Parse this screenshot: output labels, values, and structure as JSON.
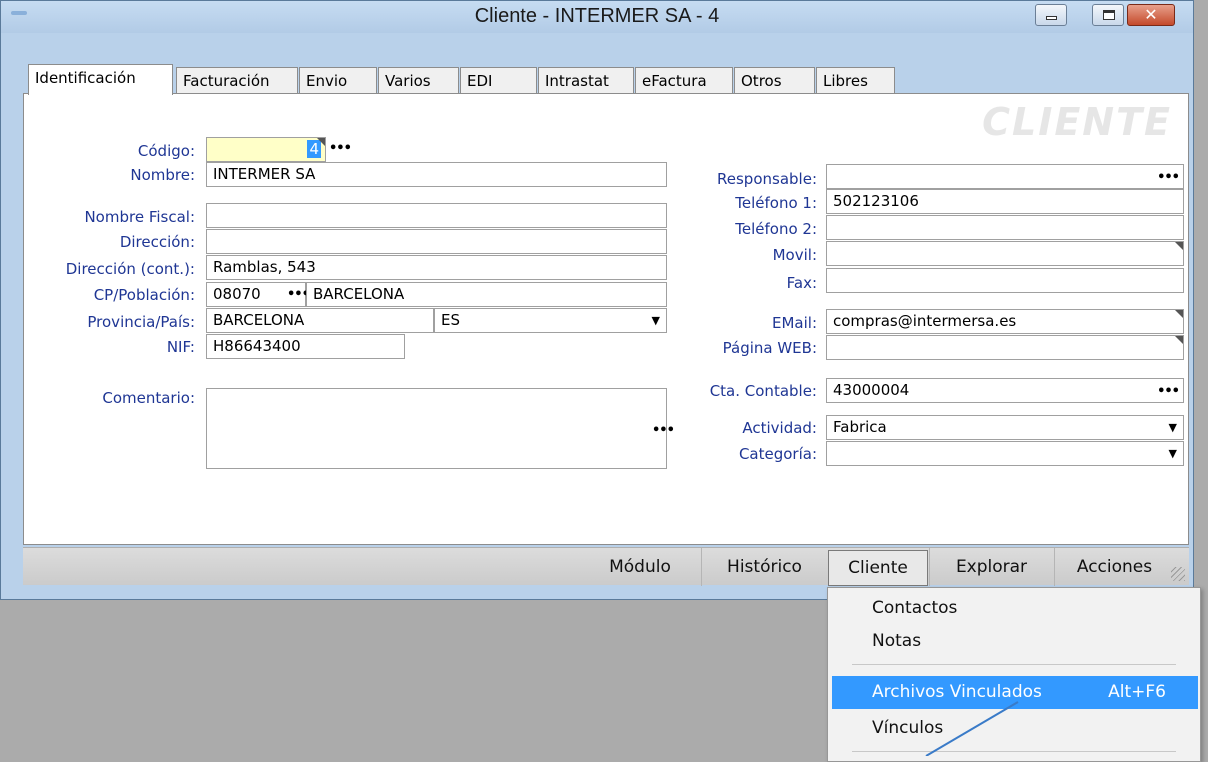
{
  "window": {
    "title": "Cliente - INTERMER SA - 4",
    "close_glyph": "✕"
  },
  "tabs": [
    "Identificación",
    "Facturación",
    "Envio",
    "Varios",
    "EDI",
    "Intrastat",
    "eFactura",
    "Otros",
    "Libres"
  ],
  "watermark": "CLIENTE",
  "left": {
    "codigo_label": "Código:",
    "codigo_value": "4",
    "nombre_label": "Nombre:",
    "nombre_value": "INTERMER SA",
    "nombre_fiscal_label": "Nombre Fiscal:",
    "nombre_fiscal_value": "",
    "direccion_label": "Dirección:",
    "direccion_value": "",
    "direccion_cont_label": "Dirección (cont.):",
    "direccion_cont_value": "Ramblas, 543",
    "cp_label": "CP/Población:",
    "cp_value": "08070",
    "poblacion_value": "BARCELONA",
    "provincia_label": "Provincia/País:",
    "provincia_value": "BARCELONA",
    "pais_value": "ES",
    "nif_label": "NIF:",
    "nif_value": "H86643400",
    "comentario_label": "Comentario:",
    "comentario_value": ""
  },
  "right": {
    "responsable_label": "Responsable:",
    "responsable_value": "",
    "telefono1_label": "Teléfono 1:",
    "telefono1_value": "502123106",
    "telefono2_label": "Teléfono 2:",
    "telefono2_value": "",
    "movil_label": "Movil:",
    "movil_value": "",
    "fax_label": "Fax:",
    "fax_value": "",
    "email_label": "EMail:",
    "email_value": "compras@intermersa.es",
    "web_label": "Página WEB:",
    "web_value": "",
    "cta_label": "Cta. Contable:",
    "cta_value": "43000004",
    "actividad_label": "Actividad:",
    "actividad_value": "Fabrica",
    "categoria_label": "Categoría:",
    "categoria_value": ""
  },
  "bottom_bar": [
    "Módulo",
    "Histórico",
    "Cliente",
    "Explorar",
    "Acciones"
  ],
  "menu": {
    "items": [
      {
        "label": "Contactos",
        "shortcut": ""
      },
      {
        "label": "Notas",
        "shortcut": ""
      },
      {
        "label": "Archivos Vinculados",
        "shortcut": "Alt+F6"
      },
      {
        "label": "Vínculos",
        "shortcut": ""
      }
    ]
  },
  "glyphs": {
    "ellipsis": "•••",
    "dropdown": "▼"
  },
  "colors": {
    "label": "#1f3694",
    "highlight": "#3399ff",
    "yellow_field": "#ffffc8"
  }
}
